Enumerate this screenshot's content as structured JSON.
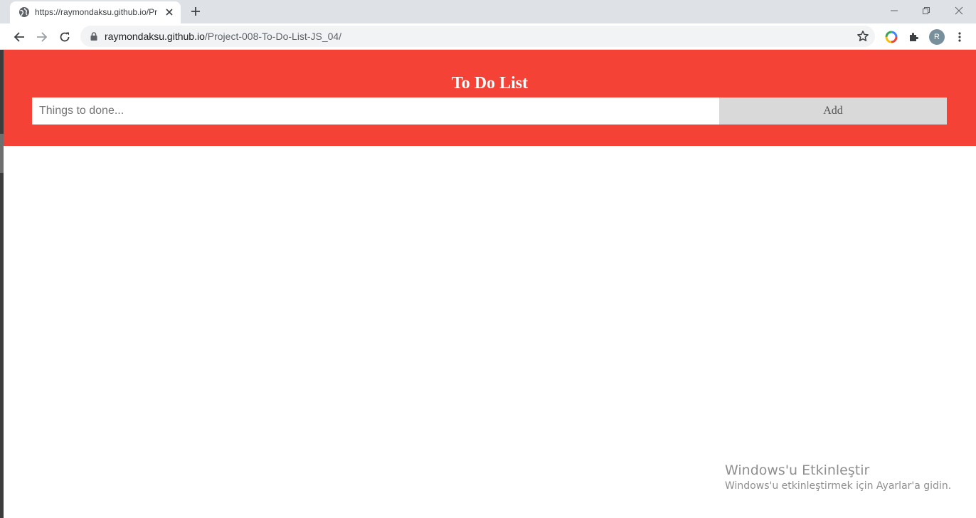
{
  "browser": {
    "tab_title": "https://raymondaksu.github.io/Pr",
    "url_host": "raymondaksu.github.io",
    "url_path": "/Project-008-To-Do-List-JS_04/",
    "profile_initial": "R"
  },
  "app": {
    "title": "To Do List",
    "input_placeholder": "Things to done...",
    "input_value": "",
    "add_label": "Add",
    "header_color": "#f44336"
  },
  "watermark": {
    "title": "Windows'u Etkinleştir",
    "subtitle": "Windows'u etkinleştirmek için Ayarlar'a gidin."
  }
}
